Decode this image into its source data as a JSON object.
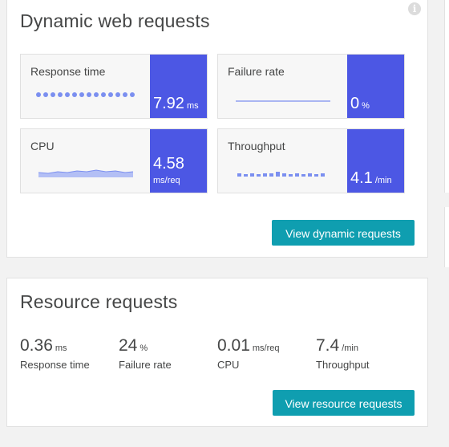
{
  "dynamic": {
    "title": "Dynamic web requests",
    "button": "View dynamic requests",
    "tiles": [
      {
        "label": "Response time",
        "value": "7.92",
        "unit": "ms"
      },
      {
        "label": "Failure rate",
        "value": "0",
        "unit": "%"
      },
      {
        "label": "CPU",
        "value": "4.58",
        "unit": "ms/req"
      },
      {
        "label": "Throughput",
        "value": "4.1",
        "unit": "/min"
      }
    ]
  },
  "resource": {
    "title": "Resource requests",
    "button": "View resource requests",
    "metrics": [
      {
        "value": "0.36",
        "unit": "ms",
        "label": "Response time"
      },
      {
        "value": "24",
        "unit": "%",
        "label": "Failure rate"
      },
      {
        "value": "0.01",
        "unit": "ms/req",
        "label": "CPU"
      },
      {
        "value": "7.4",
        "unit": "/min",
        "label": "Throughput"
      }
    ]
  },
  "colors": {
    "tile_accent": "#4c57e4",
    "sparkline": "#7b8ff0",
    "button": "#0f9eb0"
  }
}
